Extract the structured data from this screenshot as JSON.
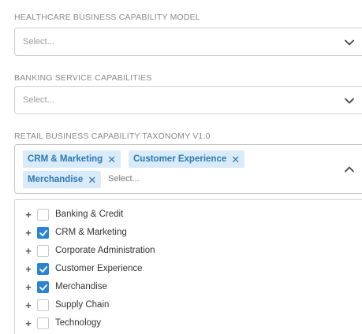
{
  "fields": [
    {
      "label": "HEALTHCARE BUSINESS CAPABILITY MODEL",
      "placeholder": "Select..."
    },
    {
      "label": "BANKING SERVICE CAPABILITIES",
      "placeholder": "Select..."
    },
    {
      "label": "RETAIL BUSINESS CAPABILITY TAXONOMY V1.0",
      "placeholder": "Select...",
      "selected_chips": [
        "CRM & Marketing",
        "Customer Experience",
        "Merchandise"
      ],
      "chip_remove_glyph": "✕"
    }
  ],
  "tree": {
    "expand_glyph": "+",
    "items": [
      {
        "label": "Banking & Credit",
        "checked": false
      },
      {
        "label": "CRM & Marketing",
        "checked": true
      },
      {
        "label": "Corporate Administration",
        "checked": false
      },
      {
        "label": "Customer Experience",
        "checked": true
      },
      {
        "label": "Merchandise",
        "checked": true
      },
      {
        "label": "Supply Chain",
        "checked": false
      },
      {
        "label": "Technology",
        "checked": false
      }
    ]
  },
  "colors": {
    "accent": "#2a84d0",
    "chip_background": "#d9ebf9",
    "chip_text": "#2b78b4",
    "label_gray": "#8a8a8a"
  },
  "icons": {
    "collapsed_chevron": "chevron-down-icon",
    "expanded_chevron": "chevron-up-icon",
    "check": "checkmark-icon",
    "remove": "close-icon",
    "expand": "plus-icon"
  }
}
